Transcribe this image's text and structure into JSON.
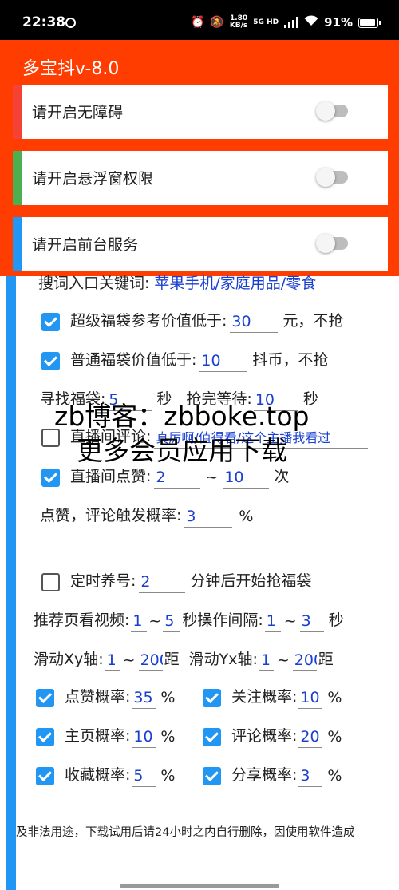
{
  "status": {
    "time": "22:38",
    "speed_top": "1.80",
    "speed_bottom": "KB/s",
    "network": "5G HD",
    "battery": "91%"
  },
  "app": {
    "title": "多宝抖v-8.0"
  },
  "permissions": [
    {
      "label": "请开启无障碍",
      "color": "#f44336",
      "enabled": false
    },
    {
      "label": "请开启悬浮窗权限",
      "color": "#4caf50",
      "enabled": false
    },
    {
      "label": "请开启前台服务",
      "color": "#2196f3",
      "enabled": false
    }
  ],
  "settings": {
    "keyword_label": "搜词入口关键词:",
    "keyword_value": "苹果手机/家庭用品/零食",
    "super_bag_label": "超级福袋参考价值低于:",
    "super_bag_value": "30",
    "super_bag_suffix": "元，不抢",
    "normal_bag_label": "普通福袋价值低于:",
    "normal_bag_value": "10",
    "normal_bag_suffix": "抖币，不抢",
    "find_label": "寻找福袋:",
    "find_value": "5",
    "find_unit": "秒",
    "wait_label": "抢完等待:",
    "wait_value": "10",
    "wait_unit": "秒",
    "comment_label": "直播间评论:",
    "comment_value": "真厉啊/值得看/这个主播我看过",
    "like_label": "直播间点赞:",
    "like_min": "2",
    "like_sep": "~",
    "like_max": "10",
    "like_unit": "次",
    "trigger_label": "点赞，评论触发概率:",
    "trigger_value": "3",
    "trigger_unit": "%",
    "nurture_label": "定时养号:",
    "nurture_value": "2",
    "nurture_suffix": "分钟后开始抢福袋",
    "rec_label": "推荐页看视频:",
    "rec_min": "1",
    "rec_sep": "~",
    "rec_max": "5",
    "rec_unit": "秒",
    "op_label": "操作间隔:",
    "op_min": "1",
    "op_sep": "~",
    "op_max": "3",
    "op_unit": "秒",
    "slide_x_label": "滑动Xy轴:",
    "slide_x_min": "1",
    "slide_x_sep": "~",
    "slide_x_max": "200",
    "slide_x_unit": "距",
    "slide_y_label": "滑动Yx轴:",
    "slide_y_min": "1",
    "slide_y_sep": "~",
    "slide_y_max": "200",
    "slide_y_unit": "距",
    "like_prob_label": "点赞概率:",
    "like_prob_value": "35",
    "follow_prob_label": "关注概率:",
    "follow_prob_value": "10",
    "home_prob_label": "主页概率:",
    "home_prob_value": "10",
    "comment_prob_label": "评论概率:",
    "comment_prob_value": "20",
    "fav_prob_label": "收藏概率:",
    "fav_prob_value": "5",
    "share_prob_label": "分享概率:",
    "share_prob_value": "3",
    "percent": "%"
  },
  "checkboxes": {
    "super_bag": true,
    "normal_bag": true,
    "comment": false,
    "like": true,
    "nurture": false,
    "like_prob": true,
    "follow_prob": true,
    "home_prob": true,
    "comment_prob": true,
    "fav_prob": true,
    "share_prob": true
  },
  "watermark": {
    "line1": "zb博客：zbboke.top",
    "line2": "更多会员应用下载"
  },
  "disclaimer": "及非法用途，下载试用后请24小时之内自行删除，因使用软件造成"
}
